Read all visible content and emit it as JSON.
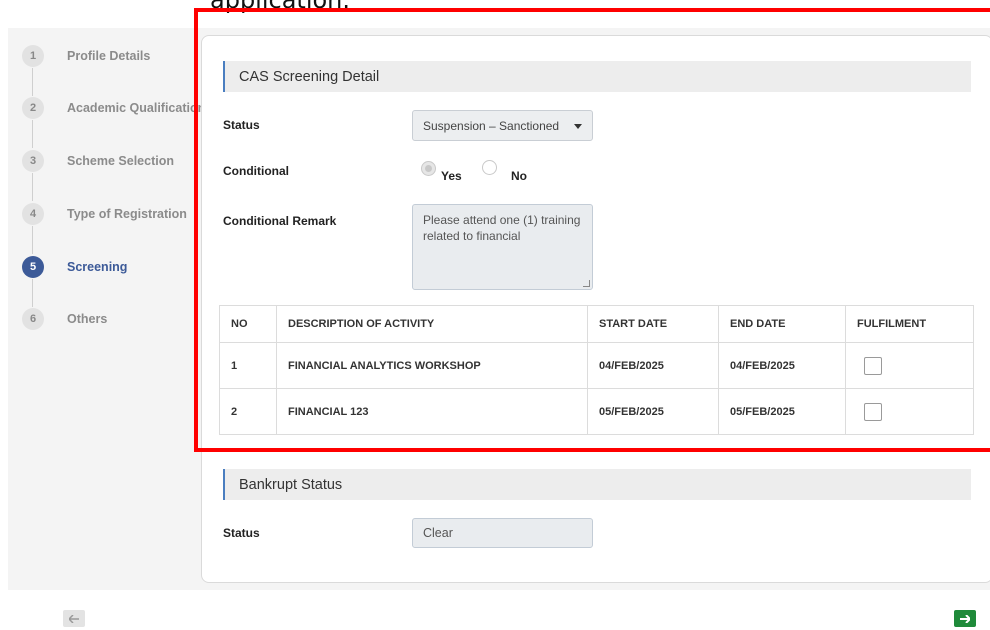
{
  "caption": "application.",
  "steps": [
    {
      "num": "1",
      "label": "Profile Details"
    },
    {
      "num": "2",
      "label": "Academic Qualification"
    },
    {
      "num": "3",
      "label": "Scheme Selection"
    },
    {
      "num": "4",
      "label": "Type of Registration"
    },
    {
      "num": "5",
      "label": "Screening"
    },
    {
      "num": "6",
      "label": "Others"
    }
  ],
  "active_step": 5,
  "cas": {
    "title": "CAS Screening Detail",
    "status_label": "Status",
    "status_value": "Suspension – Sanctioned",
    "conditional_label": "Conditional",
    "yes_label": "Yes",
    "no_label": "No",
    "conditional_selected": "Yes",
    "remark_label": "Conditional Remark",
    "remark_value": "Please attend one (1) training related to financial"
  },
  "activities": {
    "headers": [
      "NO",
      "DESCRIPTION OF ACTIVITY",
      "START DATE",
      "END DATE",
      "FULFILMENT"
    ],
    "rows": [
      {
        "no": "1",
        "desc": "FINANCIAL ANALYTICS WORKSHOP",
        "start": "04/FEB/2025",
        "end": "04/FEB/2025",
        "fulfilled": false
      },
      {
        "no": "2",
        "desc": "FINANCIAL 123",
        "start": "05/FEB/2025",
        "end": "05/FEB/2025",
        "fulfilled": false
      }
    ]
  },
  "bankrupt": {
    "title": "Bankrupt Status",
    "status_label": "Status",
    "status_value": "Clear"
  },
  "nav": {
    "prev_icon": "arrow-left-icon",
    "next_icon": "arrow-right-icon"
  },
  "colors": {
    "highlight": "#ff0000",
    "active_step": "#3c5a98",
    "next_button": "#1f8a3a",
    "section_accent": "#4a7ec0"
  }
}
